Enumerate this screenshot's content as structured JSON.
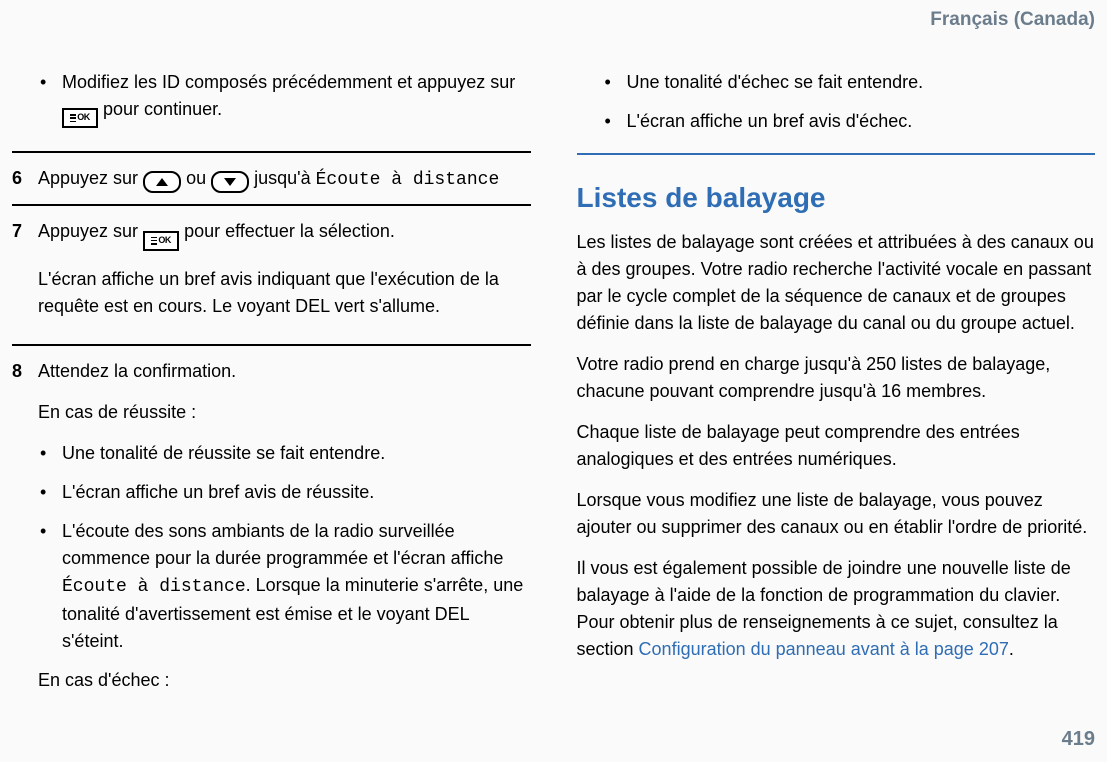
{
  "header": {
    "lang": "Français (Canada)"
  },
  "pageNumber": "419",
  "left": {
    "stepContinued": {
      "bullet": {
        "pre": "Modifiez les ID composés précédemment et appuyez sur ",
        "post": " pour continuer."
      }
    },
    "step6": {
      "num": "6",
      "pre": "Appuyez sur ",
      "mid": " ou ",
      "post": " jusqu'à ",
      "menu": "Écoute à distance"
    },
    "step7": {
      "num": "7",
      "line1_pre": "Appuyez sur ",
      "line1_post": " pour effectuer la sélection.",
      "line2": "L'écran affiche un bref avis indiquant que l'exécution de la requête est en cours. Le voyant DEL vert s'allume."
    },
    "step8": {
      "num": "8",
      "line1": "Attendez la confirmation.",
      "success_label": "En cas de réussite :",
      "bullets_success": [
        "Une tonalité de réussite se fait entendre.",
        "L'écran affiche un bref avis de réussite."
      ],
      "bullet3_pre": "L'écoute des sons ambiants de la radio surveillée commence pour la durée programmée et l'écran affiche ",
      "bullet3_mono": "Écoute à distance",
      "bullet3_post": ". Lorsque la minuterie s'arrête, une tonalité d'avertissement est émise et le voyant DEL s'éteint.",
      "fail_label": "En cas d'échec :"
    }
  },
  "right": {
    "bullets_fail": [
      "Une tonalité d'échec se fait entendre.",
      "L'écran affiche un bref avis d'échec."
    ],
    "section_title": "Listes de balayage",
    "p1": "Les listes de balayage sont créées et attribuées à des canaux ou à des groupes. Votre radio recherche l'activité vocale en passant par le cycle complet de la séquence de canaux et de groupes définie dans la liste de balayage du canal ou du groupe actuel.",
    "p2": "Votre radio prend en charge jusqu'à 250 listes de balayage, chacune pouvant comprendre jusqu'à 16 membres.",
    "p3": "Chaque liste de balayage peut comprendre des entrées analogiques et des entrées numériques.",
    "p4": "Lorsque vous modifiez une liste de balayage, vous pouvez ajouter ou supprimer des canaux ou en établir l'ordre de priorité.",
    "p5_pre": "Il vous est également possible de joindre une nouvelle liste de balayage à l'aide de la fonction de programmation du clavier. Pour obtenir plus de renseignements à ce sujet, consultez la section ",
    "p5_link": "Configuration du panneau avant à la page 207",
    "p5_post": "."
  },
  "icons": {
    "okLabel": "OK"
  }
}
